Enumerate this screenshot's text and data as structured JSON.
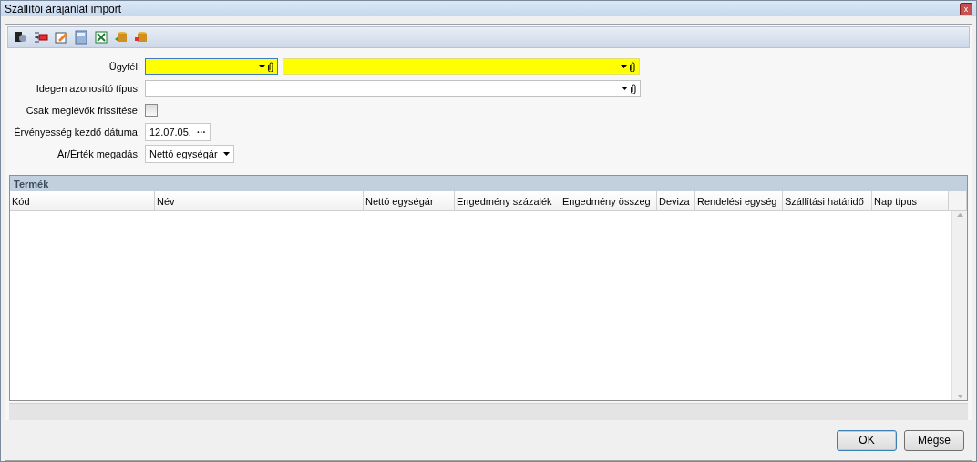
{
  "window": {
    "title": "Szállítói árajánlat import",
    "close_label": "x"
  },
  "form": {
    "rows": [
      {
        "kind": "combo",
        "label": "Ügyfél:",
        "fields": [
          {
            "required": true,
            "focused": true,
            "wide": false
          },
          {
            "required": true,
            "focused": false,
            "wide": true
          }
        ]
      },
      {
        "kind": "combo",
        "label": "Idegen azonosító típus:",
        "fields": [
          {
            "required": false,
            "focused": false,
            "wide": true
          }
        ]
      },
      {
        "kind": "checkbox",
        "label": "Csak meglévők frissítése:",
        "checked": false
      },
      {
        "kind": "date",
        "label": "Érvényesség kezdő dátuma:",
        "value": "12.07.05.",
        "button": "···"
      },
      {
        "kind": "select",
        "label": "Ár/Érték megadás:",
        "value": "Nettó egységár"
      }
    ]
  },
  "table": {
    "title": "Termék",
    "columns": [
      "Kód",
      "Név",
      "Nettó egységár",
      "Engedmény százalék",
      "Engedmény összeg",
      "Deviza",
      "Rendelési egység",
      "Szállítási határidő",
      "Nap típus"
    ]
  },
  "buttons": [
    {
      "label": "OK",
      "default": true
    },
    {
      "label": "Mégse",
      "default": false
    }
  ]
}
